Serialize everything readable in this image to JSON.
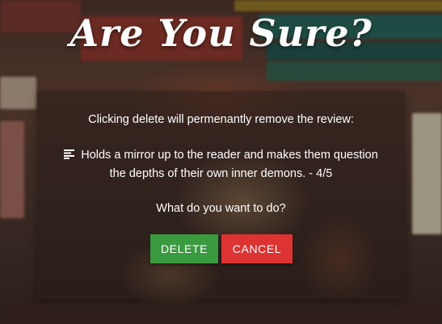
{
  "dialog": {
    "title": "Are You Sure?",
    "message": "Clicking delete will permenantly remove the review:",
    "review_icon": "notes-lines-icon",
    "review_line1": "Holds a mirror up to the reader and makes them question",
    "review_line2": "the depths of their own inner demons. - 4/5",
    "question": "What do you want to do?",
    "delete_label": "DELETE",
    "cancel_label": "CANCEL"
  },
  "colors": {
    "delete": "#3a9a40",
    "cancel": "#dd3333"
  }
}
